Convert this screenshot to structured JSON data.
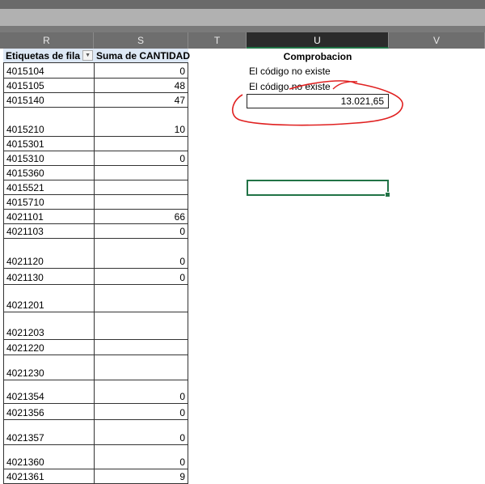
{
  "columns": [
    "R",
    "S",
    "T",
    "U",
    "V"
  ],
  "pivot": {
    "header_labels": "Etiquetas de fila",
    "header_values": "Suma de CANTIDAD",
    "rows": [
      {
        "code": "4015104",
        "value": "0"
      },
      {
        "code": "4015105",
        "value": "48"
      },
      {
        "code": "4015140",
        "value": "47"
      },
      {
        "code": "4015210",
        "value": "10"
      },
      {
        "code": "4015301",
        "value": ""
      },
      {
        "code": "4015310",
        "value": "0"
      },
      {
        "code": "4015360",
        "value": ""
      },
      {
        "code": "4015521",
        "value": ""
      },
      {
        "code": "4015710",
        "value": ""
      },
      {
        "code": "4021101",
        "value": "66"
      },
      {
        "code": "4021103",
        "value": "0"
      },
      {
        "code": "4021120",
        "value": "0"
      },
      {
        "code": "4021130",
        "value": "0"
      },
      {
        "code": "4021201",
        "value": ""
      },
      {
        "code": "4021203",
        "value": ""
      },
      {
        "code": "4021220",
        "value": ""
      },
      {
        "code": "4021230",
        "value": ""
      },
      {
        "code": "4021354",
        "value": "0"
      },
      {
        "code": "4021356",
        "value": "0"
      },
      {
        "code": "4021357",
        "value": "0"
      },
      {
        "code": "4021360",
        "value": "0"
      },
      {
        "code": "4021361",
        "value": "9"
      }
    ]
  },
  "check": {
    "title": "Comprobacion",
    "line1": "El código no existe",
    "line2": "El código no existe",
    "total": "13.021,65"
  },
  "colors": {
    "annotation": "#e02020",
    "selection": "#217346"
  }
}
